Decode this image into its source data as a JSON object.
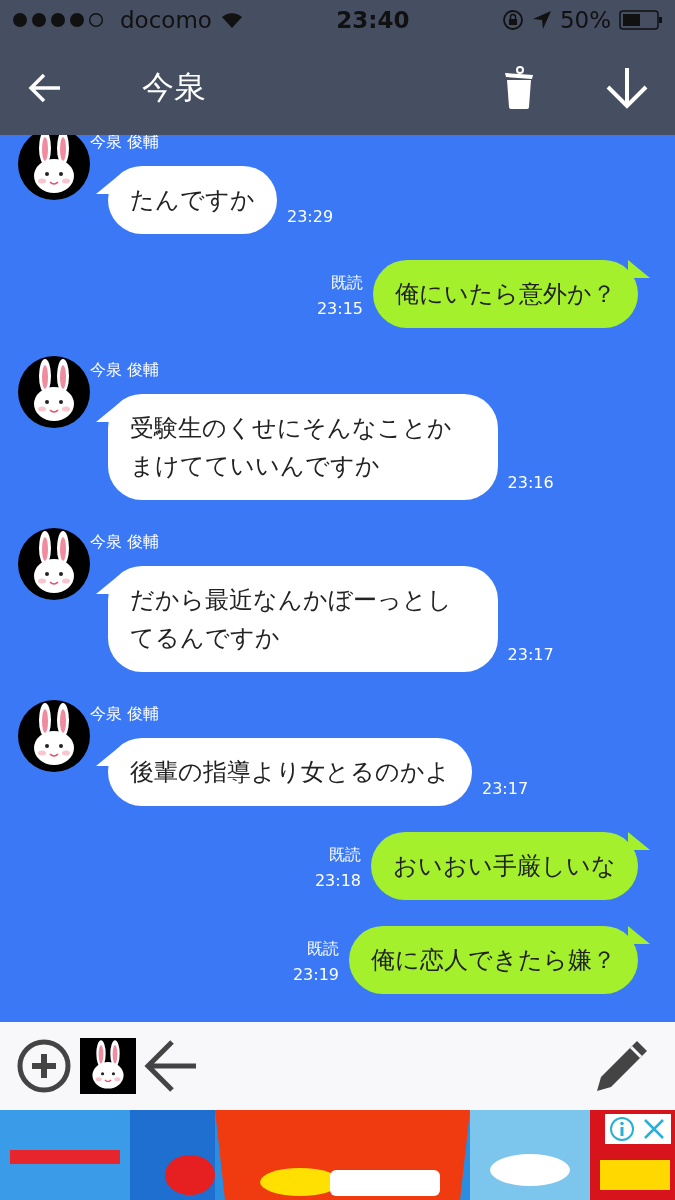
{
  "status_bar": {
    "carrier": "docomo",
    "time": "23:40",
    "battery": "50%"
  },
  "header": {
    "title": "今泉"
  },
  "messages": [
    {
      "kind": "incoming",
      "sender": "今泉 俊輔",
      "text": "たんですか",
      "time": "23:29"
    },
    {
      "kind": "outgoing",
      "read": "既読",
      "time": "23:15",
      "text": "俺にいたら意外か？"
    },
    {
      "kind": "incoming",
      "sender": "今泉 俊輔",
      "text": "受験生のくせにそんなことかまけてていいんですか",
      "time": "23:16"
    },
    {
      "kind": "incoming",
      "sender": "今泉 俊輔",
      "text": "だから最近なんかぼーっとしてるんですか",
      "time": "23:17"
    },
    {
      "kind": "incoming",
      "sender": "今泉 俊輔",
      "text": "後輩の指導より女とるのかよ",
      "time": "23:17"
    },
    {
      "kind": "outgoing",
      "read": "既読",
      "time": "23:18",
      "text": "おいおい手厳しいな"
    },
    {
      "kind": "outgoing",
      "read": "既読",
      "time": "23:19",
      "text": "俺に恋人できたら嫌？"
    }
  ]
}
